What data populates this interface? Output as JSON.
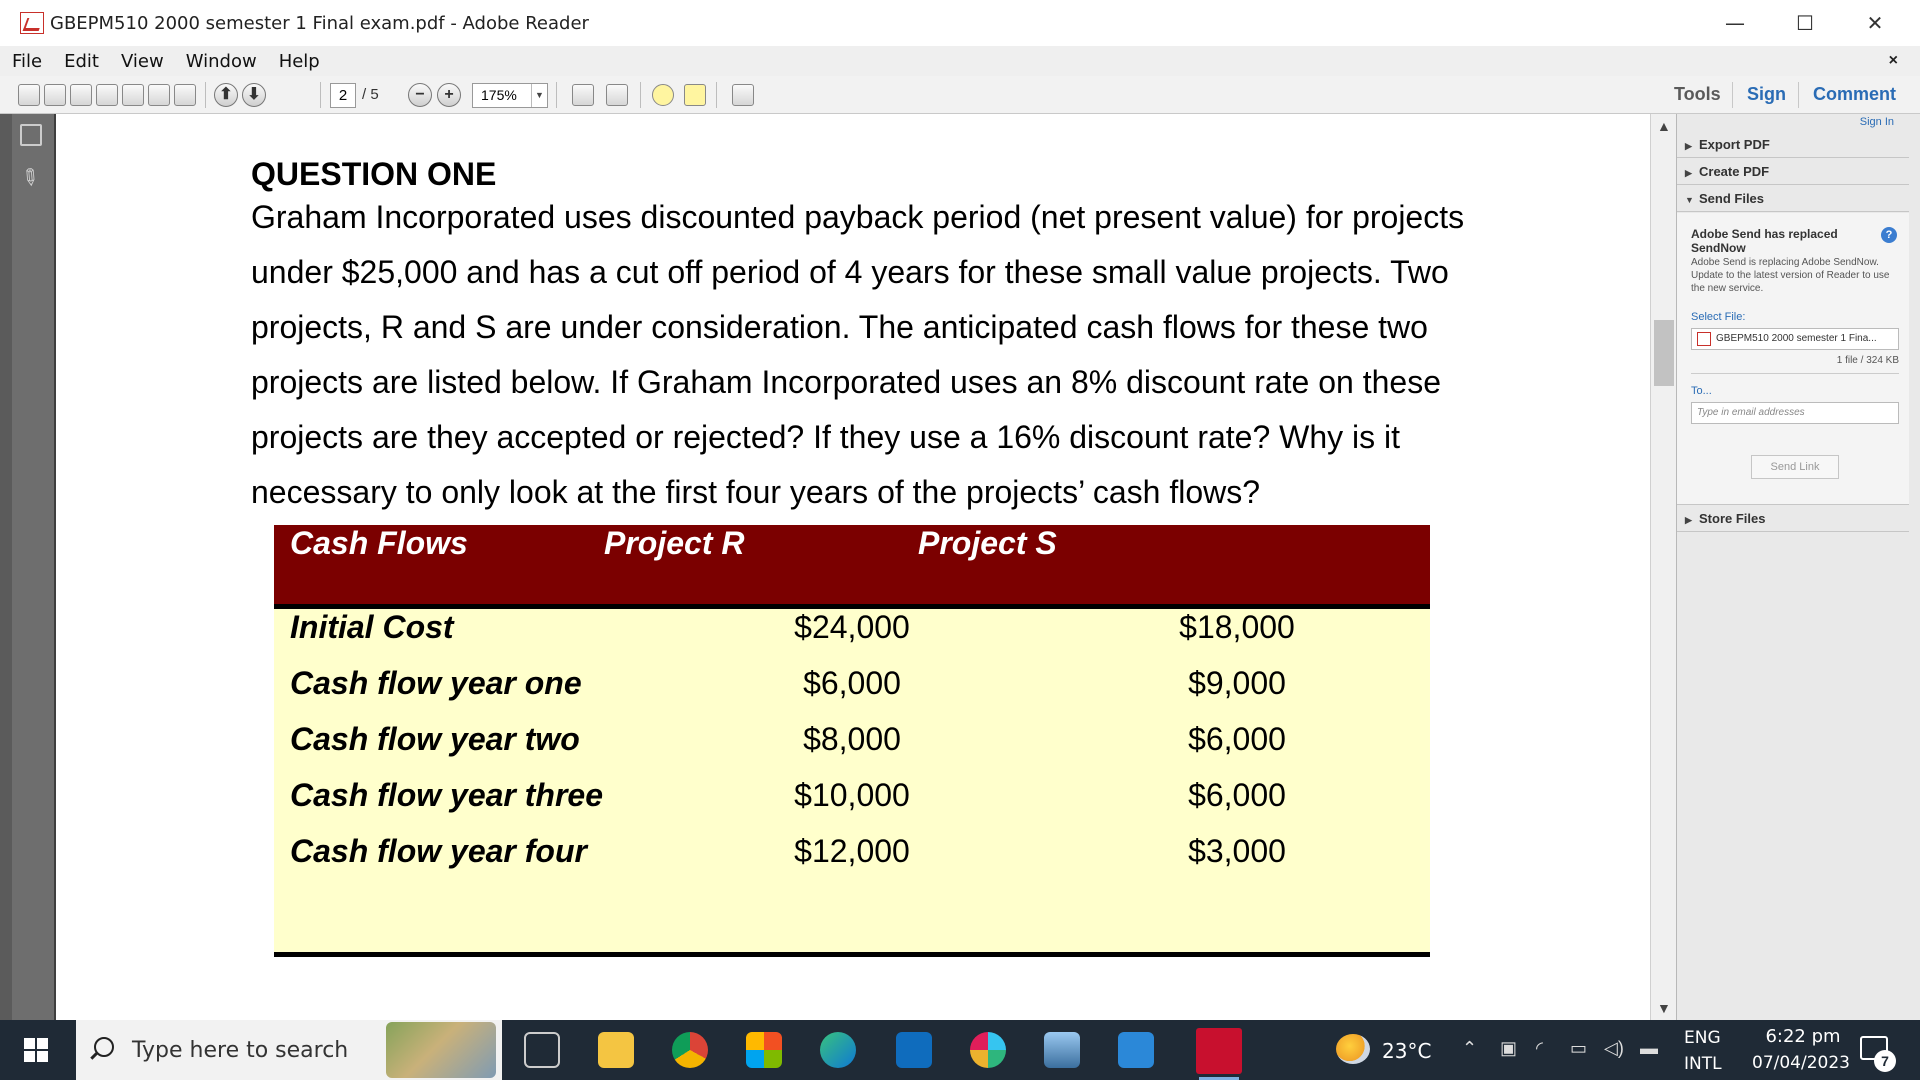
{
  "window": {
    "title": "GBEPM510 2000 semester 1 Final  exam.pdf - Adobe Reader",
    "minimize": "—",
    "maximize": "☐",
    "close": "✕"
  },
  "menu": {
    "items": [
      "File",
      "Edit",
      "View",
      "Window",
      "Help"
    ],
    "close_doc": "×"
  },
  "toolbar": {
    "page_current": "2",
    "page_total": "/ 5",
    "zoom": "175%",
    "zoom_out": "−",
    "zoom_in": "+",
    "prev_page": "⬆",
    "next_page": "⬇",
    "tools": "Tools",
    "sign": "Sign",
    "comment": "Comment"
  },
  "document": {
    "heading": "QUESTION ONE",
    "paragraph_lines": [
      "Graham Incorporated uses discounted payback period (net present value) for projects",
      "under $25,000 and has a cut off period of 4 years for these small value projects. Two",
      "projects, R and S are under consideration. The anticipated cash flows for these two",
      "projects are listed below. If Graham Incorporated uses an 8% discount rate on these",
      "projects are they accepted or rejected? If they use a 16% discount rate? Why is it",
      "necessary to only look at the first four years of the projects’ cash flows?"
    ],
    "table": {
      "headers": [
        "Cash Flows",
        "Project R",
        "Project S"
      ],
      "rows": [
        {
          "label": "Initial Cost",
          "r": "$24,000",
          "s": "$18,000"
        },
        {
          "label": "Cash flow year one",
          "r": "$6,000",
          "s": "$9,000"
        },
        {
          "label": "Cash flow year two",
          "r": "$8,000",
          "s": "$6,000"
        },
        {
          "label": "Cash flow year three",
          "r": "$10,000",
          "s": "$6,000"
        },
        {
          "label": "Cash flow year four",
          "r": "$12,000",
          "s": "$3,000"
        }
      ]
    }
  },
  "right_panel": {
    "sign_in": "Sign In",
    "export_pdf": "Export PDF",
    "create_pdf": "Create PDF",
    "send_files": "Send Files",
    "send_title": "Adobe Send has replaced SendNow",
    "send_desc": "Adobe Send is replacing Adobe SendNow. Update to the latest version of Reader to use the new service.",
    "select_file_label": "Select File:",
    "selected_file": "GBEPM510 2000 semester 1 Fina...",
    "file_count": "1 file / 324 KB",
    "to_label": "To...",
    "email_placeholder": "Type in email addresses",
    "send_link": "Send Link",
    "store_files": "Store Files"
  },
  "taskbar": {
    "search_placeholder": "Type here to search",
    "temperature": "23°C",
    "lang_top": "ENG",
    "lang_bottom": "INTL",
    "time": "6:22 pm",
    "date": "07/04/2023",
    "notification_count": "7"
  },
  "colors": {
    "table_header": "#7b0000",
    "table_body": "#ffffcc",
    "accent_blue": "#2a6cb5",
    "taskbar": "#1f2a36"
  }
}
